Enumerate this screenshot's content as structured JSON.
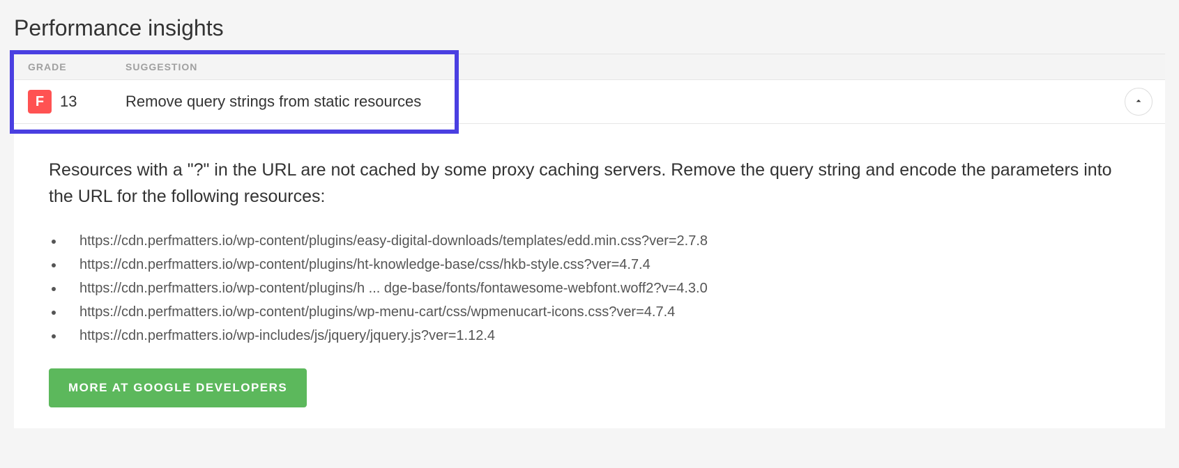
{
  "title": "Performance insights",
  "columns": {
    "grade": "GRADE",
    "suggestion": "SUGGESTION"
  },
  "insight": {
    "grade_letter": "F",
    "grade_score": "13",
    "suggestion": "Remove query strings from static resources"
  },
  "detail": {
    "description": "Resources with a \"?\" in the URL are not cached by some proxy caching servers. Remove the query string and encode the parameters into the URL for the following resources:",
    "resources": [
      "https://cdn.perfmatters.io/wp-content/plugins/easy-digital-downloads/templates/edd.min.css?ver=2.7.8",
      "https://cdn.perfmatters.io/wp-content/plugins/ht-knowledge-base/css/hkb-style.css?ver=4.7.4",
      "https://cdn.perfmatters.io/wp-content/plugins/h ... dge-base/fonts/fontawesome-webfont.woff2?v=4.3.0",
      "https://cdn.perfmatters.io/wp-content/plugins/wp-menu-cart/css/wpmenucart-icons.css?ver=4.7.4",
      "https://cdn.perfmatters.io/wp-includes/js/jquery/jquery.js?ver=1.12.4"
    ],
    "button_label": "MORE AT GOOGLE DEVELOPERS"
  }
}
